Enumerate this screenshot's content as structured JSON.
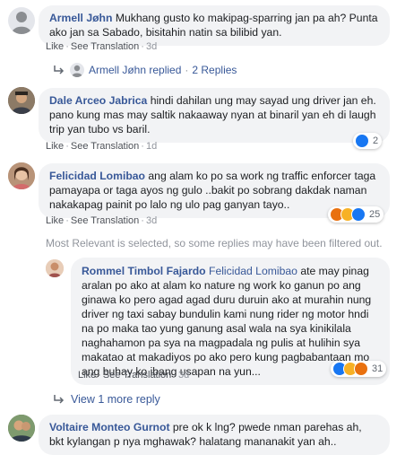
{
  "comments": [
    {
      "author": "Armell Jøhn",
      "text": "Mukhang gusto ko makipag-sparring jan pa ah? Punta ako jan sa Sabado, bisitahin natin sa bilibid yan.",
      "like": "Like",
      "translate": "See Translation",
      "time": "3d",
      "replies_author": "Armell Jøhn replied",
      "replies_count": "2 Replies"
    },
    {
      "author": "Dale Arceo Jabrica",
      "text": "hindi dahilan ung may sayad ung driver jan eh. pano kung mas may saltik nakaaway nyan at binaril yan eh di laugh trip yan tubo vs baril.",
      "like": "Like",
      "translate": "See Translation",
      "time": "1d",
      "reaction_count": "2"
    },
    {
      "author": "Felicidad Lomibao",
      "text": "ang alam ko po sa work ng traffic enforcer taga pamayapa or taga ayos ng gulo ..bakit po sobrang dakdak naman nakakapag painit po lalo ng ulo pag ganyan tayo..",
      "like": "Like",
      "translate": "See Translation",
      "time": "3d",
      "reaction_count": "25"
    }
  ],
  "filter_note": "Most Relevant is selected, so some replies may have been filtered out.",
  "reply": {
    "author": "Rommel Timbol Fajardo",
    "tag": "Felicidad Lomibao",
    "text": "ate may pinag aralan po ako at alam ko nature ng work ko ganun po ang ginawa ko pero agad agad duru duruin ako at murahin nung driver ng taxi sabay bundulin kami nung rider ng motor hndi na po maka tao yung ganung asal wala na sya kinikilala naghahamon pa sya na magpadala ng pulis at hulihin sya makatao at makadiyos po ako pero kung pagbabantaan mo ang buhay ko ibang usapan na yun...",
    "like": "Like",
    "translate": "See Translation",
    "time": "3d",
    "reaction_count": "31"
  },
  "more_replies": "View 1 more reply",
  "last_comment": {
    "author": "Voltaire Monteo Gurnot",
    "text": "pre ok k lng? pwede nman parehas ah, bkt kylangan p nya mghawak? halatang mananakit yan ah.."
  },
  "colors": {
    "link": "#385898",
    "bubble": "#f2f3f5",
    "muted": "#90949c",
    "like_blue": "#1877f2"
  }
}
